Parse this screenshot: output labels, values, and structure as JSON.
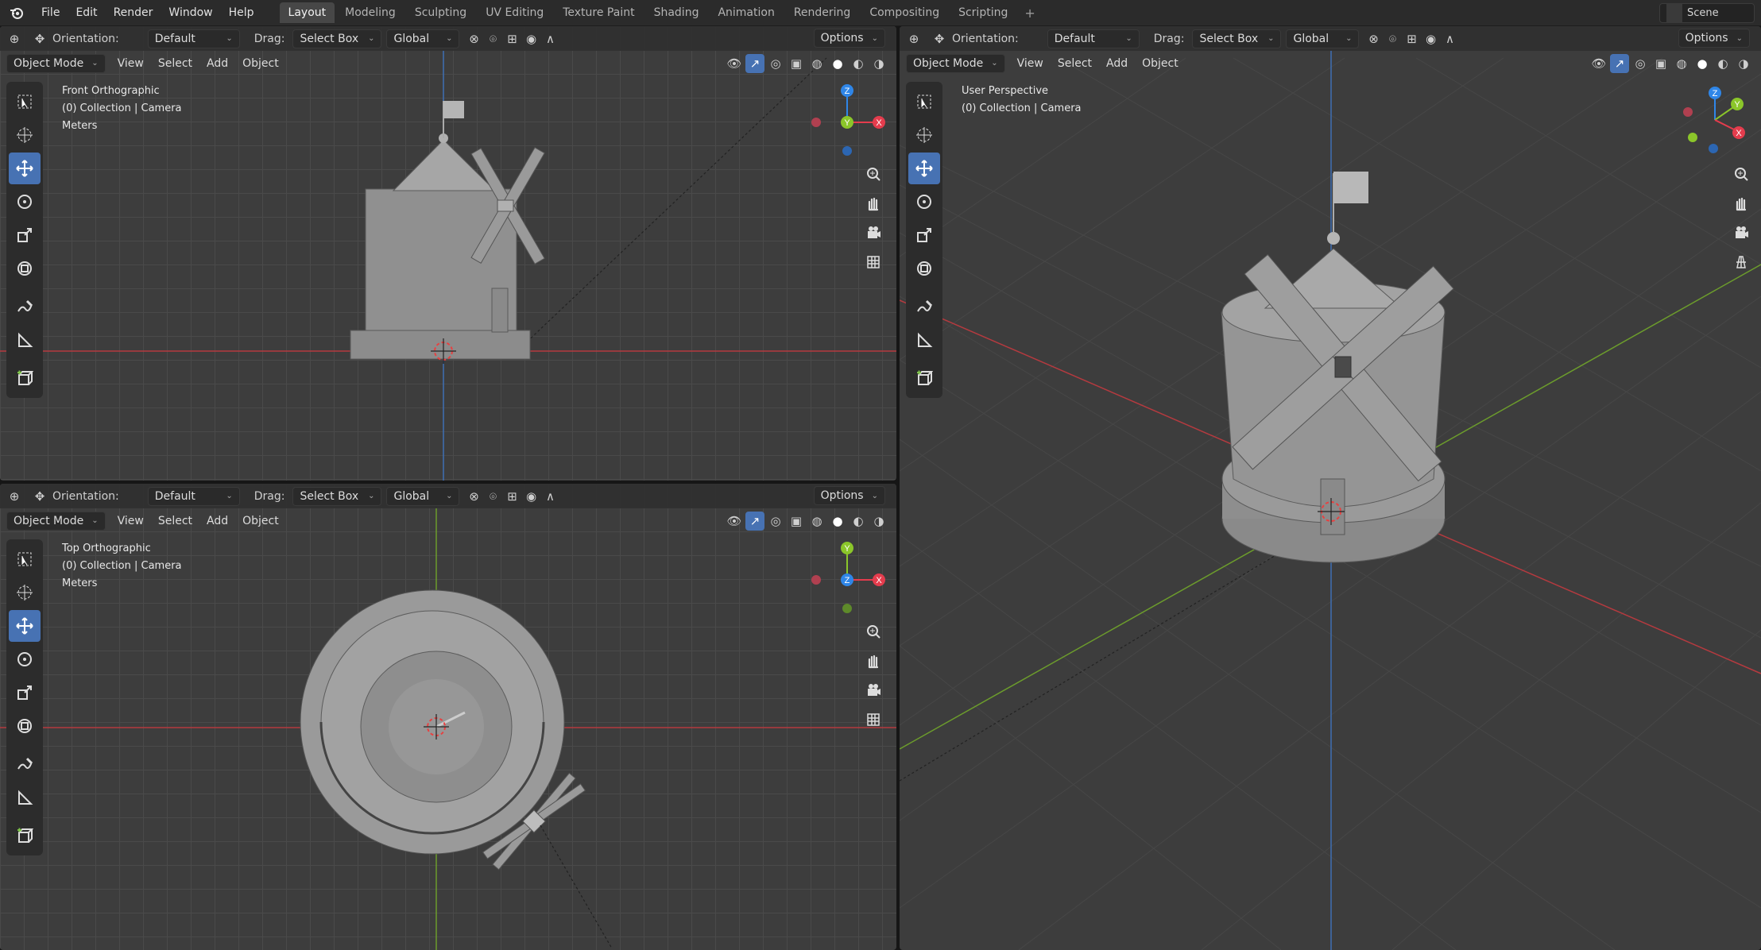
{
  "menubar": {
    "items": [
      "File",
      "Edit",
      "Render",
      "Window",
      "Help"
    ],
    "workspaces": [
      "Layout",
      "Modeling",
      "Sculpting",
      "UV Editing",
      "Texture Paint",
      "Shading",
      "Animation",
      "Rendering",
      "Compositing",
      "Scripting"
    ],
    "active": "Layout",
    "add": "+",
    "scene": "Scene"
  },
  "header": {
    "orientation_label": "Orientation:",
    "orientation_value": "Default",
    "drag_label": "Drag:",
    "drag_value": "Select Box",
    "transform": "Global",
    "options": "Options"
  },
  "subheader": {
    "mode": "Object Mode",
    "view": "View",
    "select": "Select",
    "add": "Add",
    "object": "Object"
  },
  "viewports": {
    "front": {
      "title": "Front Orthographic",
      "collection": "(0) Collection | Camera",
      "units": "Meters"
    },
    "top": {
      "title": "Top Orthographic",
      "collection": "(0) Collection | Camera",
      "units": "Meters"
    },
    "user": {
      "title": "User Perspective",
      "collection": "(0) Collection | Camera"
    }
  },
  "gizmo": {
    "x": "X",
    "y": "Y",
    "z": "Z"
  },
  "colors": {
    "x_axis": "#e43c4d",
    "y_axis": "#8bc62a",
    "z_axis": "#2f86e8",
    "active_tool": "#4772b3"
  }
}
